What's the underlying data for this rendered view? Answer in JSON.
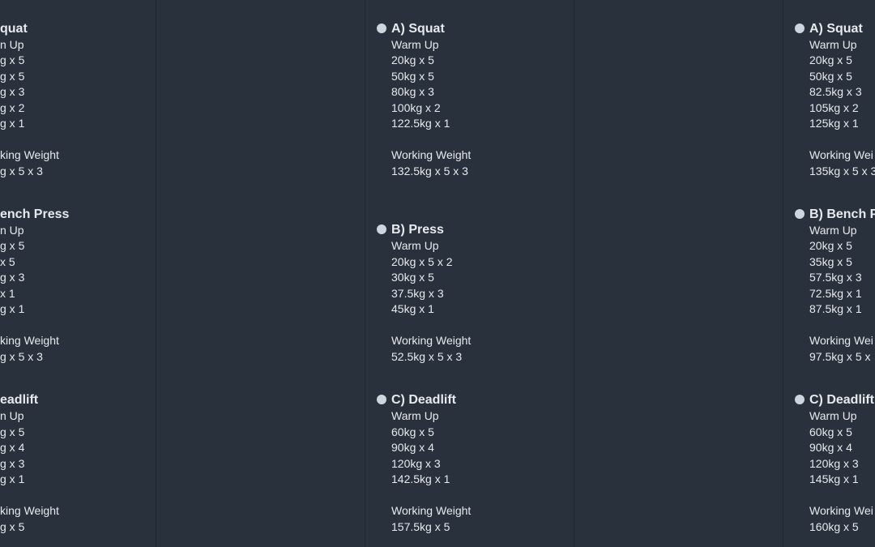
{
  "columns": [
    {
      "clipped": true,
      "exercises": [
        {
          "title": "quat",
          "lines": [
            "n Up",
            "g x 5",
            "g x 5",
            "g x 3",
            "g x 2",
            "g x 1",
            "",
            "king Weight",
            "g x 5 x 3"
          ]
        },
        {
          "title": "ench Press",
          "lines": [
            "n Up",
            "g x 5",
            "x 5",
            "g x 3",
            "x 1",
            "g x 1",
            "",
            "king Weight",
            "g x 5 x 3"
          ]
        },
        {
          "title": "eadlift",
          "lines": [
            "n Up",
            "g x 5",
            "g x 4",
            "g x 3",
            "g x 1",
            "",
            "king Weight",
            "g x 5"
          ]
        }
      ]
    },
    {
      "clipped": false,
      "exercises": [
        {
          "title": "A) Squat",
          "lines": [
            "Warm Up",
            "20kg x 5",
            "50kg x 5",
            "80kg x 3",
            "100kg x 2",
            "122.5kg x 1",
            "",
            "Working Weight",
            "132.5kg x 5 x 3"
          ]
        },
        {
          "title": "B) Press",
          "lines": [
            "Warm Up",
            "20kg x 5 x 2",
            "30kg x 5",
            "37.5kg x 3",
            "45kg x 1",
            "",
            "Working Weight",
            "52.5kg x 5 x 3"
          ]
        },
        {
          "title": "C) Deadlift",
          "lines": [
            "Warm Up",
            "60kg x 5",
            "90kg x 4",
            "120kg x 3",
            "142.5kg x 1",
            "",
            "Working Weight",
            "157.5kg x 5"
          ]
        }
      ]
    },
    {
      "clipped": true,
      "exercises": [
        {
          "title": "A) Squat",
          "lines": [
            "Warm Up",
            "20kg x 5",
            "50kg x 5",
            "82.5kg x 3",
            "105kg x 2",
            "125kg x 1",
            "",
            "Working Wei",
            "135kg x 5 x 3"
          ]
        },
        {
          "title": "B) Bench P",
          "lines": [
            "Warm Up",
            "20kg x 5",
            "35kg x 5",
            "57.5kg x 3",
            "72.5kg x 1",
            "87.5kg x 1",
            "",
            "Working Wei",
            "97.5kg x 5 x"
          ]
        },
        {
          "title": "C) Deadlift",
          "lines": [
            "Warm Up",
            "60kg x 5",
            "90kg x 4",
            "120kg x 3",
            "145kg x 1",
            "",
            "Working Wei",
            "160kg x 5"
          ]
        }
      ]
    }
  ],
  "colors": {
    "background": "#29323c",
    "text": "#e6eaee",
    "bullet": "#cdd5de",
    "divider": "#1f262e"
  }
}
